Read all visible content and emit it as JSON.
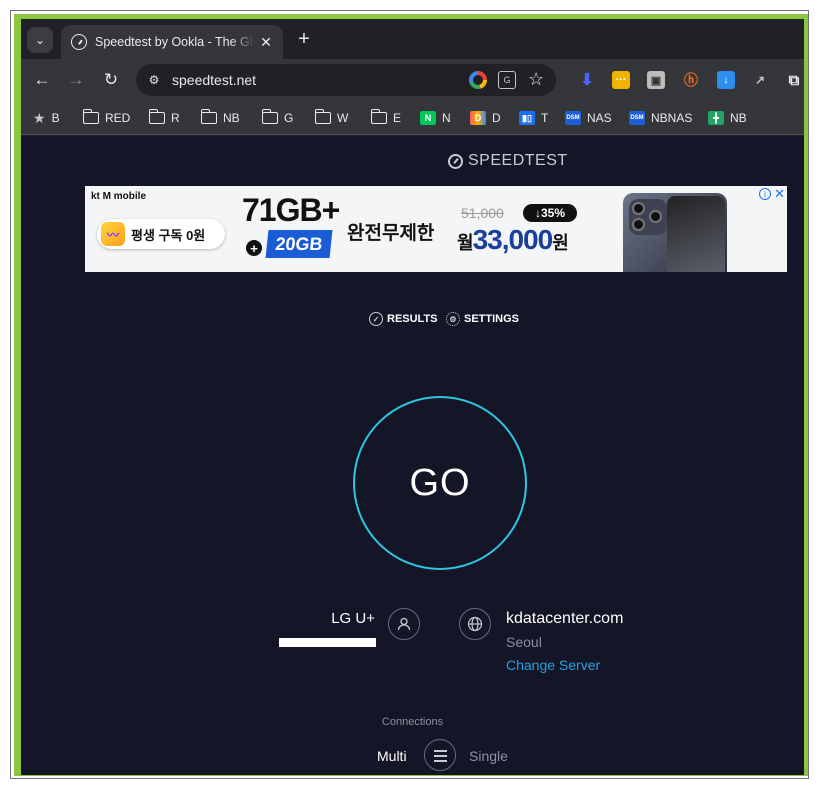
{
  "browser": {
    "tab": {
      "title": "Speedtest by Ookla - The Global Broadband Speed Test",
      "close": "✕"
    },
    "new_tab": "+",
    "tab_search": "⌄",
    "nav": {
      "back": "←",
      "forward": "→",
      "reload": "↻"
    },
    "url": "speedtest.net",
    "bookmark_star": "☆",
    "bookmarks": [
      {
        "label": "B",
        "icon": "star-icon"
      },
      {
        "label": "RED",
        "icon": "folder-icon"
      },
      {
        "label": "R",
        "icon": "folder-icon"
      },
      {
        "label": "NB",
        "icon": "folder-icon"
      },
      {
        "label": "G",
        "icon": "folder-icon"
      },
      {
        "label": "W",
        "icon": "folder-icon"
      },
      {
        "label": "E",
        "icon": "folder-icon"
      },
      {
        "label": "N",
        "icon": "naver-icon"
      },
      {
        "label": "D",
        "icon": "d-icon"
      },
      {
        "label": "T",
        "icon": "trello-icon"
      },
      {
        "label": "NAS",
        "icon": "dsm-icon"
      },
      {
        "label": "NBNAS",
        "icon": "dsm-icon"
      },
      {
        "label": "NB",
        "icon": "sheet-icon"
      }
    ],
    "colors": {
      "tab_bg": "#35363a",
      "frame_bg": "#202124",
      "accent_green": "#8cc63f"
    }
  },
  "page": {
    "logo": "SPEEDTEST",
    "ad": {
      "brand": "kt M mobile",
      "pill_text": "평생 구독 0원",
      "data": "71GB+",
      "bonus": "20GB",
      "unlimited": "완전무제한",
      "old_price": "51,000",
      "discount": "↓35%",
      "price_prefix": "월",
      "price": "33,000",
      "price_suffix": "원"
    },
    "menu": {
      "results": "RESULTS",
      "settings": "SETTINGS"
    },
    "go": "GO",
    "isp": {
      "name": "LG U+"
    },
    "server": {
      "host": "kdatacenter.com",
      "city": "Seoul",
      "change": "Change Server"
    },
    "connections": {
      "label": "Connections",
      "multi": "Multi",
      "single": "Single"
    },
    "colors": {
      "page_bg": "#141526",
      "go_ring": "#2fc4e2",
      "link": "#1fa3e3"
    }
  }
}
